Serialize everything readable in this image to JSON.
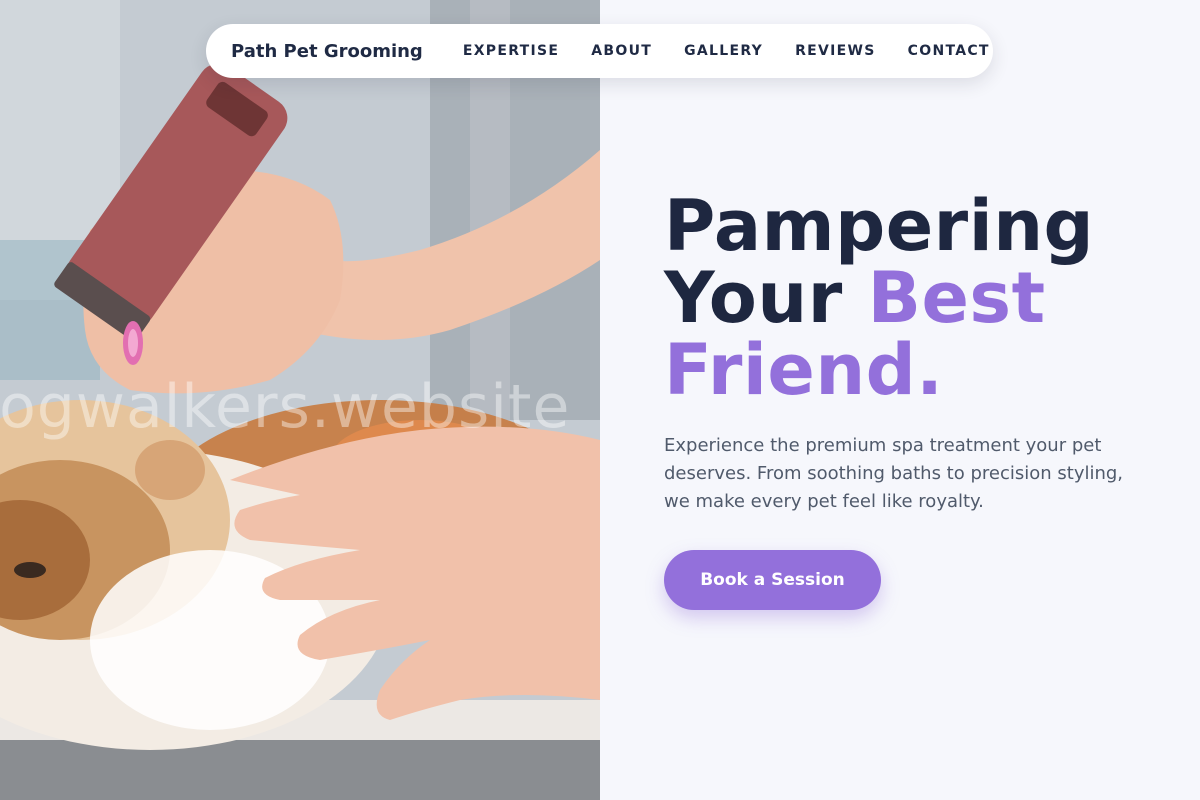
{
  "nav": {
    "brand": "Path Pet Grooming",
    "links": [
      {
        "label": "EXPERTISE"
      },
      {
        "label": "ABOUT"
      },
      {
        "label": "GALLERY"
      },
      {
        "label": "REVIEWS"
      },
      {
        "label": "CONTACT"
      }
    ]
  },
  "hero": {
    "headline_line1": "Pampering",
    "headline_line2_plain": "Your ",
    "headline_line2_accent": "Best",
    "headline_line3_accent": "Friend.",
    "description": "Experience the premium spa treatment your pet deserves. From soothing baths to precision styling, we make every pet feel like royalty.",
    "cta_label": "Book a Session"
  },
  "photo": {
    "subject": "groomer trimming a persian cat with clippers",
    "watermark": "dogwalkers.website"
  },
  "colors": {
    "accent": "#9370db",
    "heading": "#1e2740",
    "background": "#f6f7fc"
  }
}
